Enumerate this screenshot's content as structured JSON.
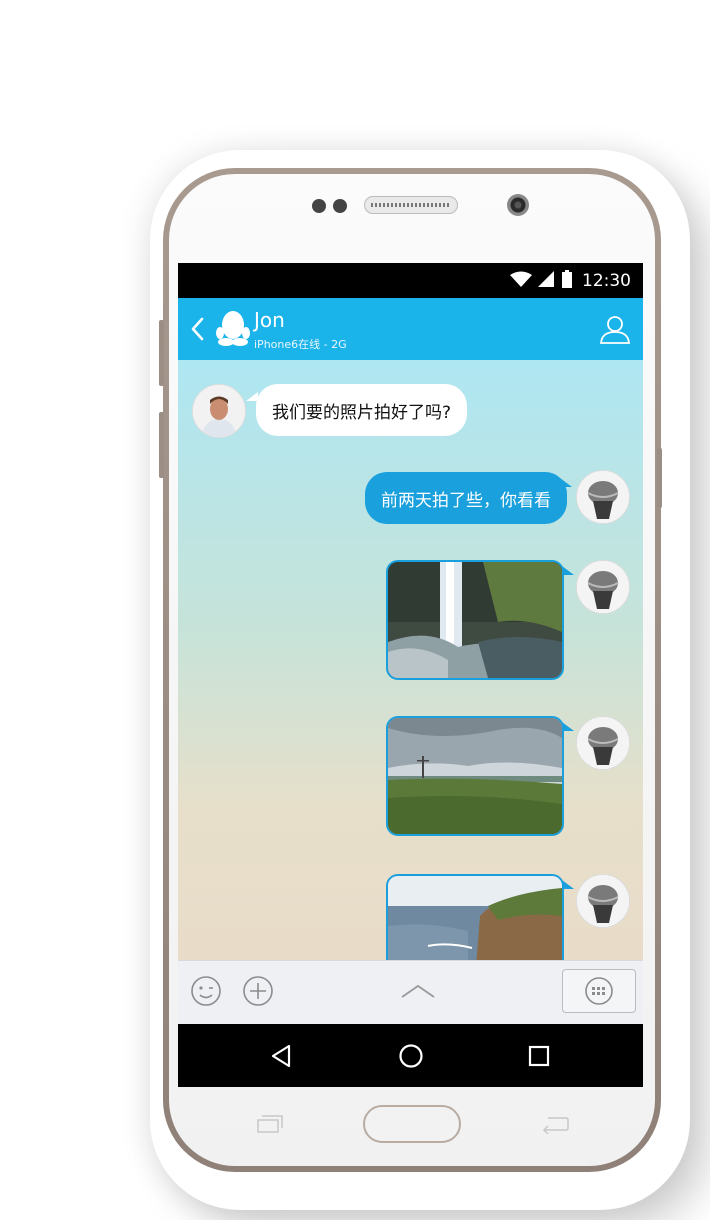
{
  "status_bar": {
    "time": "12:30",
    "icons": [
      "wifi-icon",
      "signal-icon",
      "battery-icon"
    ]
  },
  "app_bar": {
    "back_icon": "chevron-left-icon",
    "avatar_icon": "qq-penguin-icon",
    "contact_name": "Jon",
    "contact_status": "iPhone6在线 - 2G",
    "profile_icon": "user-profile-icon"
  },
  "messages": [
    {
      "from": "Jon",
      "type": "text",
      "text": "我们要的照片拍好了吗?"
    },
    {
      "from": "me",
      "type": "text",
      "text": "前两天拍了些，你看看"
    },
    {
      "from": "me",
      "type": "image",
      "subject": "waterfall"
    },
    {
      "from": "me",
      "type": "image",
      "subject": "grassland"
    },
    {
      "from": "me",
      "type": "image",
      "subject": "coastal cliff"
    }
  ],
  "input_bar": {
    "emoji_icon": "emoji-icon",
    "add_icon": "plus-circle-icon",
    "expand_icon": "chevron-up-icon",
    "keyboard_icon": "keyboard-icon"
  },
  "nav_bar": {
    "icons": [
      "back-triangle-icon",
      "home-circle-icon",
      "recents-square-icon"
    ]
  },
  "colors": {
    "accent": "#1ab3ea",
    "outgoing_bubble": "#1aa0dd",
    "incoming_bubble": "#ffffff"
  }
}
